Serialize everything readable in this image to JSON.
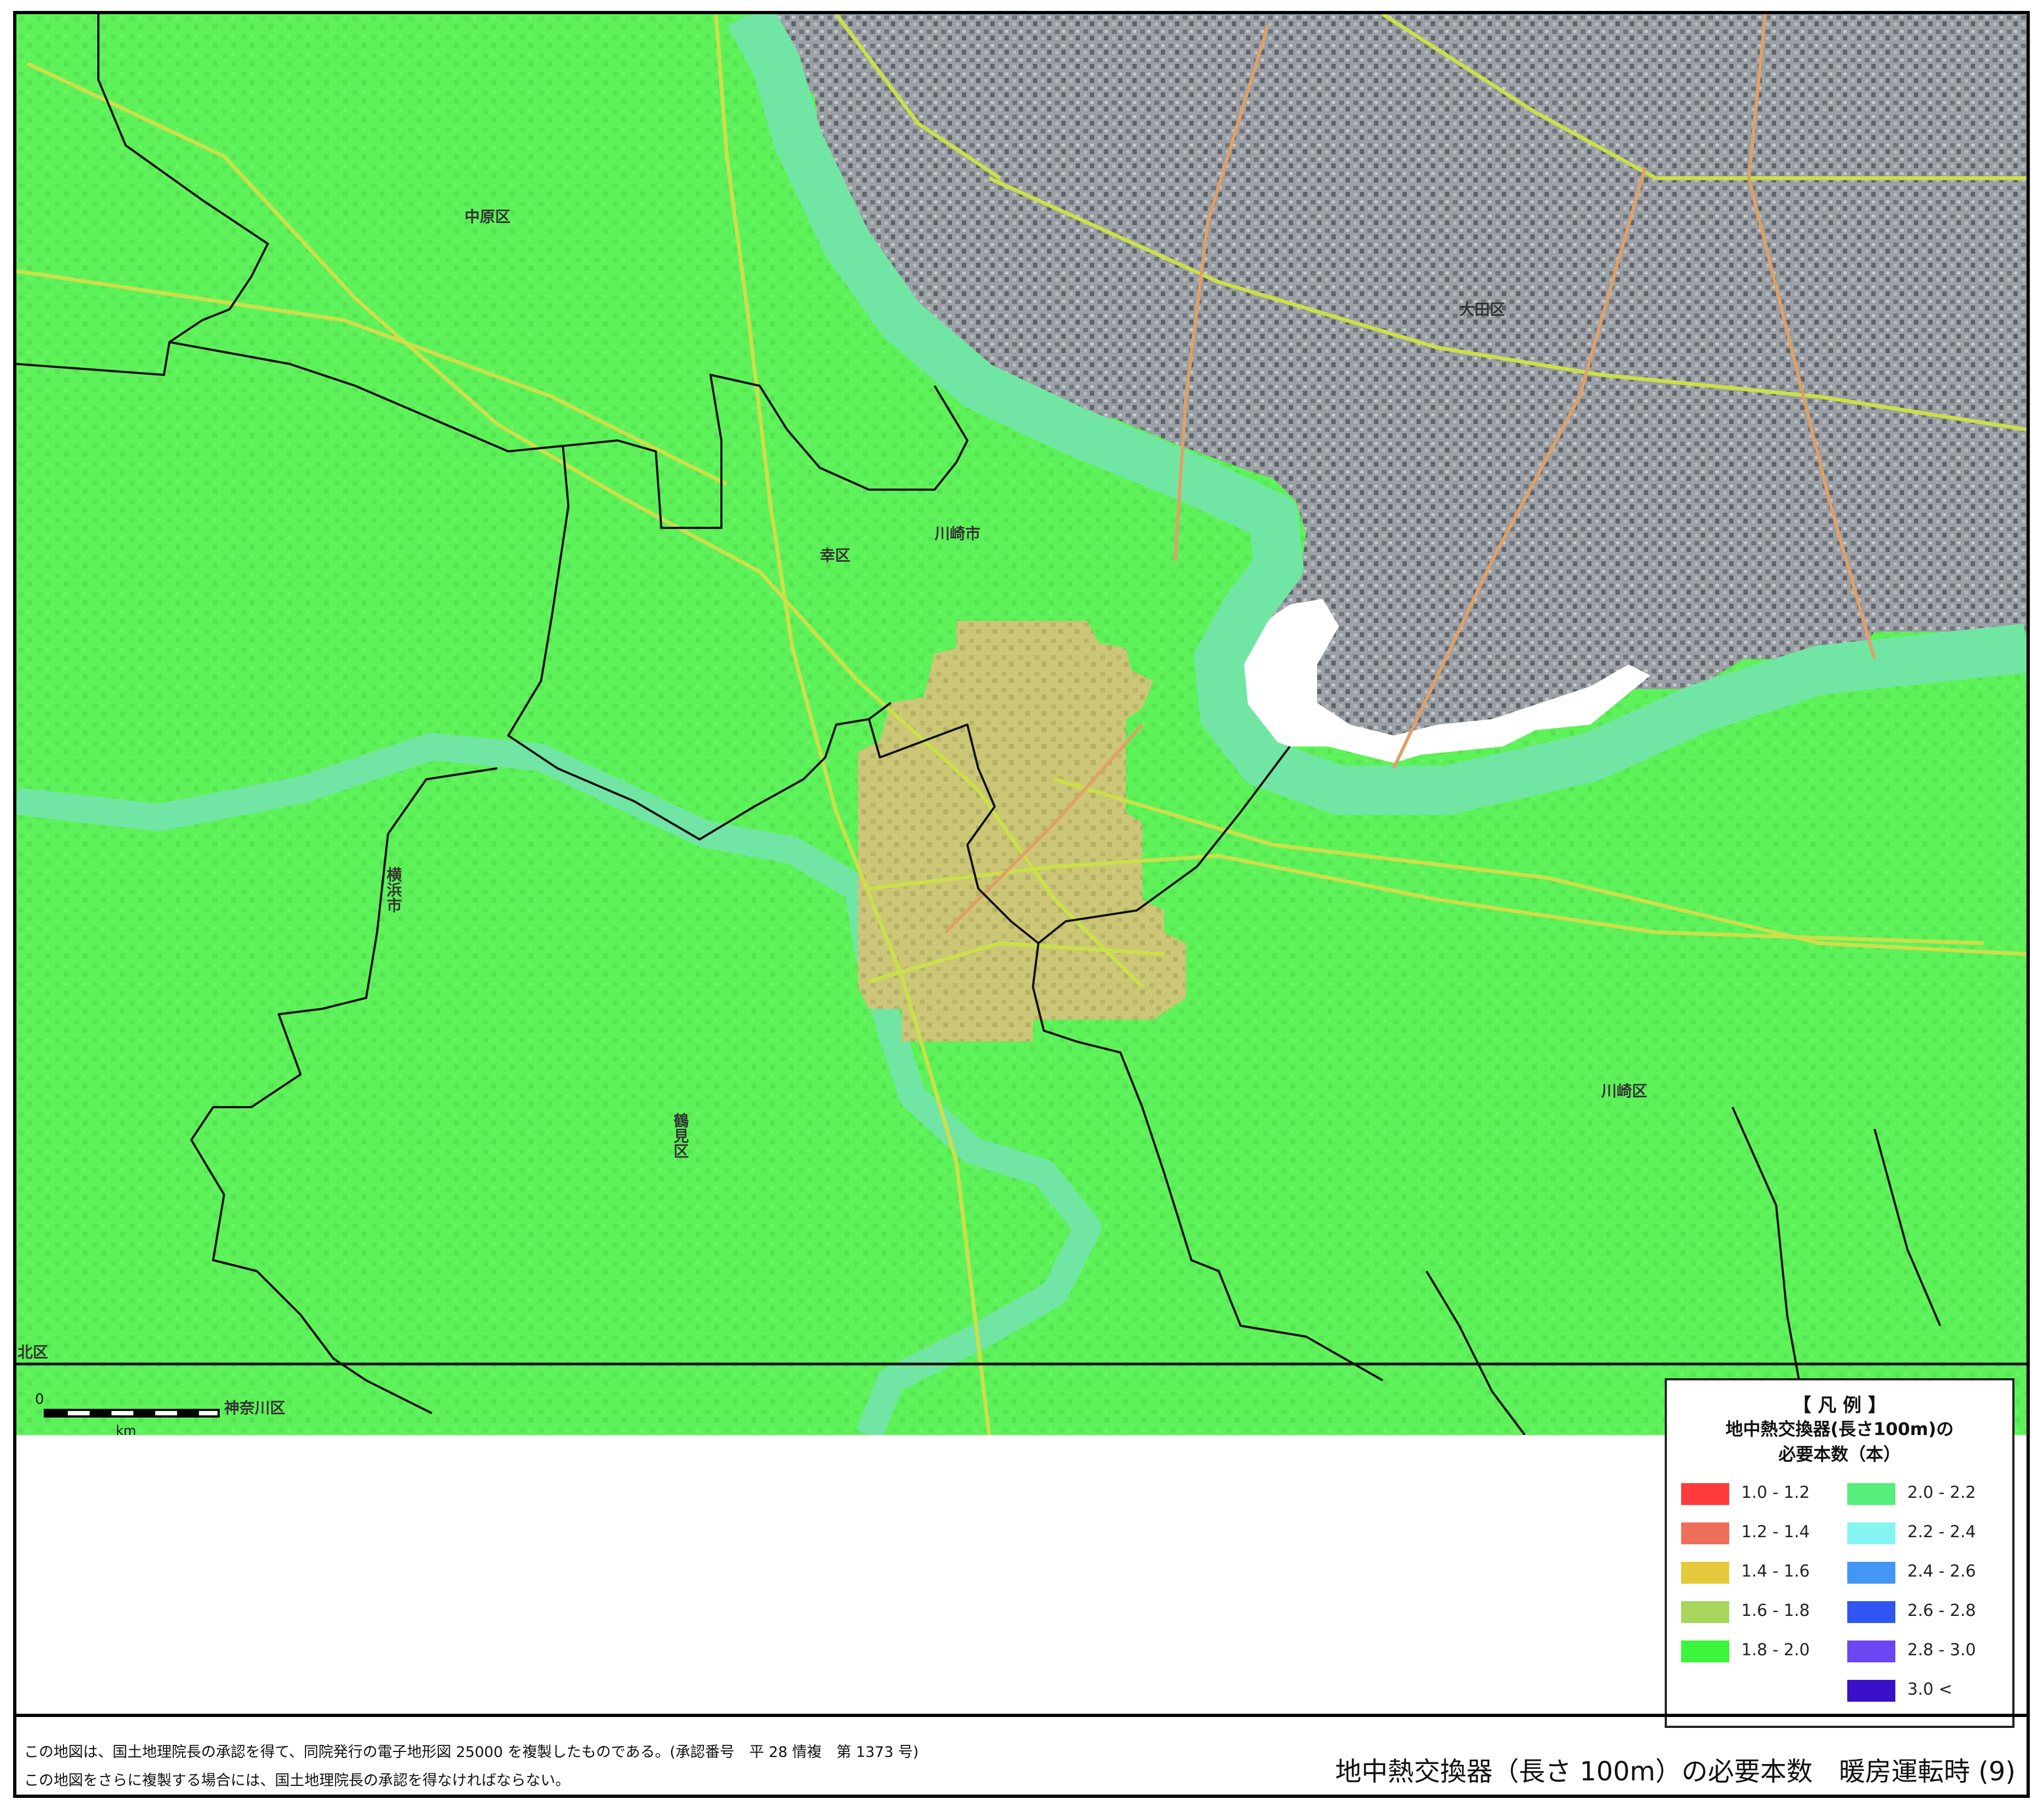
{
  "map": {
    "place_labels": {
      "nakahara": "中原区",
      "saiwai": "幸区",
      "kawasaki_city": "川崎市",
      "ota": "大田区",
      "yokohama": "横浜市",
      "tsurumi": "鶴見区",
      "kawasaki_ward": "川崎区",
      "kanagawa": "神奈川区",
      "kita": "北区"
    },
    "colors": {
      "base_green": "#5ef25a",
      "heat_yellow": "#d2c478",
      "tokyo_gray": "#8f959a",
      "boundary": "#111111",
      "river": "#71e6a4",
      "rail": "#cbe04a",
      "road": "#e0a066"
    }
  },
  "scale": {
    "zero": "0",
    "unit": "km"
  },
  "legend": {
    "title": "【 凡 例 】",
    "subtitle_line1": "地中熱交換器(長さ100m)の",
    "subtitle_line2": "必要本数（本）",
    "items": [
      {
        "range": "1.0 - 1.2",
        "color": "#ff3a3a"
      },
      {
        "range": "1.2 - 1.4",
        "color": "#ee6f5a"
      },
      {
        "range": "1.4 - 1.6",
        "color": "#e5c93a"
      },
      {
        "range": "1.6 - 1.8",
        "color": "#a6d65b"
      },
      {
        "range": "1.8 - 2.0",
        "color": "#3cf53c"
      },
      {
        "range": "2.0 - 2.2",
        "color": "#55ee7a"
      },
      {
        "range": "2.2 - 2.4",
        "color": "#84f5f2"
      },
      {
        "range": "2.4 - 2.6",
        "color": "#4496f4"
      },
      {
        "range": "2.6 - 2.8",
        "color": "#2f55f5"
      },
      {
        "range": "2.8 - 3.0",
        "color": "#6c46f0"
      },
      {
        "range": "3.0 <",
        "color": "#3a10c8"
      }
    ]
  },
  "footer": {
    "credit_line1": "この地図は、国土地理院長の承認を得て、同院発行の電子地形図 25000 を複製したものである。(承認番号　平 28 情複　第 1373 号)",
    "credit_line2": "この地図をさらに複製する場合には、国土地理院長の承認を得なければならない。",
    "title": "地中熱交換器（長さ 100m）の必要本数　暖房運転時 (9)"
  }
}
